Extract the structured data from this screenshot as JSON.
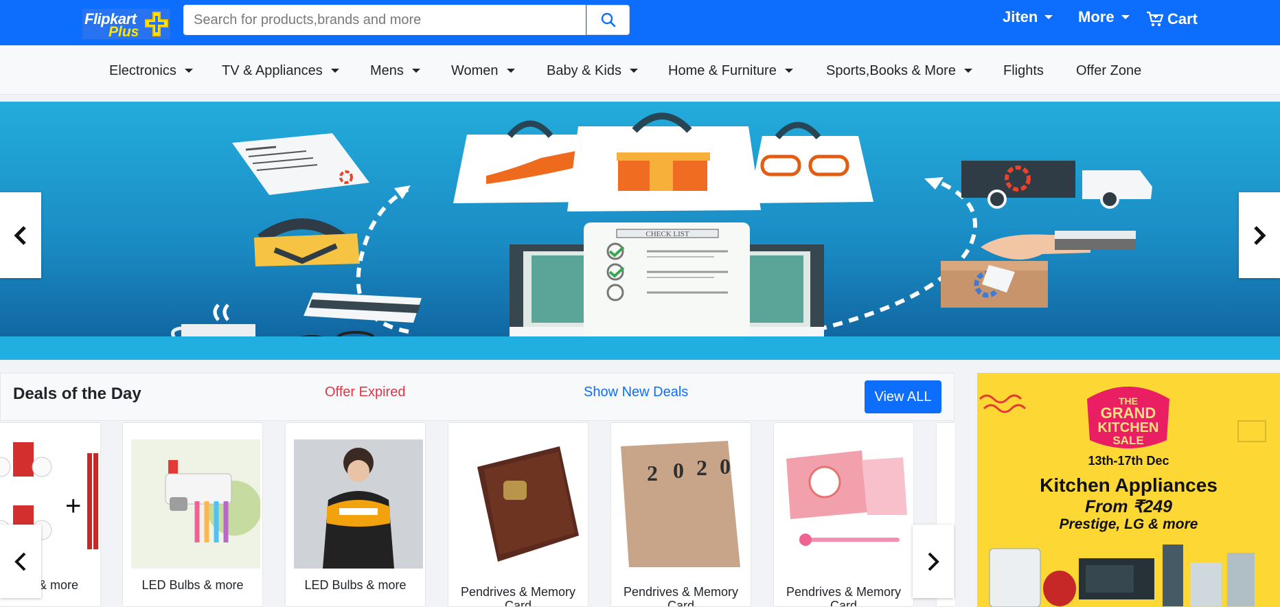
{
  "header": {
    "logo_primary": "Flipkart",
    "logo_secondary": "Plus",
    "search_placeholder": "Search for products,brands and more",
    "search_value": "",
    "user_label": "Jiten",
    "more_label": "More",
    "cart_label": "Cart",
    "brand_color": "#0d6efd"
  },
  "categories": [
    {
      "label": "Electronics",
      "has_dropdown": true
    },
    {
      "label": "TV & Appliances",
      "has_dropdown": true
    },
    {
      "label": "Mens",
      "has_dropdown": true
    },
    {
      "label": "Women",
      "has_dropdown": true
    },
    {
      "label": "Baby & Kids",
      "has_dropdown": true
    },
    {
      "label": "Home & Furniture",
      "has_dropdown": true
    },
    {
      "label": "Sports,Books & More",
      "has_dropdown": true
    },
    {
      "label": "Flights",
      "has_dropdown": false
    },
    {
      "label": "Offer Zone",
      "has_dropdown": false
    }
  ],
  "banner": {
    "checklist_text": "CHECK LIST",
    "prev_icon": "chevron-left-icon",
    "next_icon": "chevron-right-icon"
  },
  "deals": {
    "title": "Deals of the Day",
    "status": "Offer Expired",
    "show_new_label": "Show New Deals",
    "view_all_label": "View ALL",
    "status_color": "#dc3545",
    "link_color": "#0d6efd",
    "products": [
      {
        "name": "LED Bulbs & more",
        "visible_name": "lbs & more",
        "image": "bulbs-batteries"
      },
      {
        "name": "LED Bulbs & more",
        "image": "toothpaste-dispenser"
      },
      {
        "name": "LED Bulbs & more",
        "image": "kids-sweatshirt"
      },
      {
        "name": "Pendrives & Memory Card",
        "image": "leather-journal"
      },
      {
        "name": "Pendrives & Memory Card",
        "image": "2020-diary"
      },
      {
        "name": "Pendrives & Memory Card",
        "image": "unicorn-notebook"
      }
    ]
  },
  "promo": {
    "badge_line1": "THE",
    "badge_line2": "GRAND",
    "badge_line3": "KITCHEN",
    "badge_line4": "SALE",
    "dates": "13th-17th Dec",
    "headline": "Kitchen Appliances",
    "price_line": "From ₹249",
    "brands_line": "Prestige, LG & more",
    "background_color": "#fdd835"
  }
}
